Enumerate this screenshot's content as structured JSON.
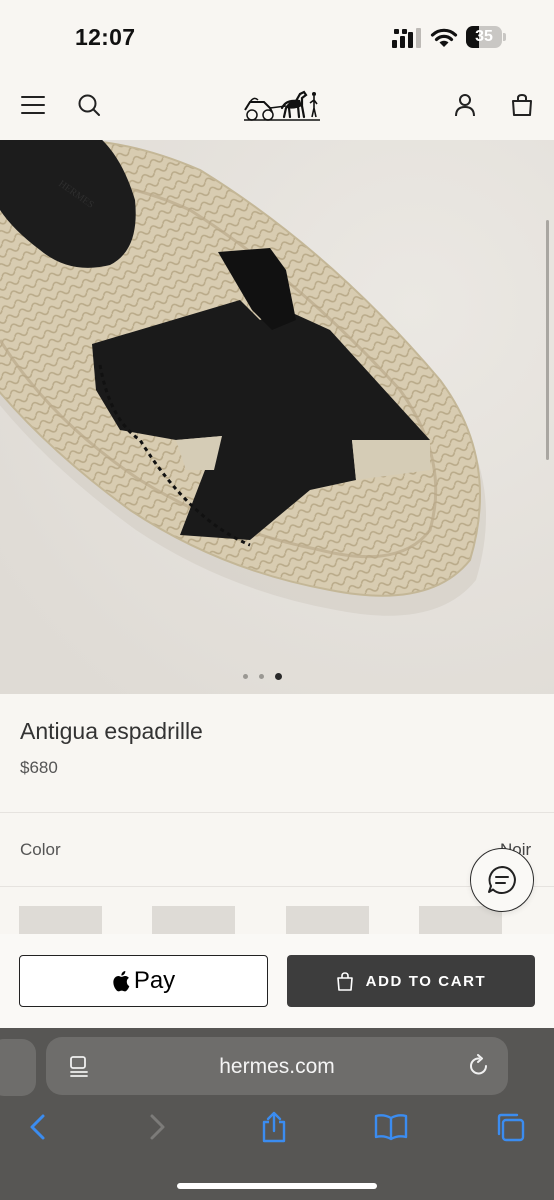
{
  "status_bar": {
    "time": "12:07",
    "battery_percent": "35",
    "icons": [
      "signal-icon",
      "wifi-icon",
      "battery-icon"
    ]
  },
  "header": {
    "icons": [
      "menu-icon",
      "search-icon",
      "hermes-logo",
      "account-icon",
      "shopping-bag-icon"
    ]
  },
  "gallery": {
    "image_count": 3,
    "active_index": 2
  },
  "product": {
    "name": "Antigua espadrille",
    "price": "$680"
  },
  "color": {
    "label": "Color",
    "value": "Noir"
  },
  "actions": {
    "apple_pay_label": "Pay",
    "add_to_cart_label": "ADD TO CART"
  },
  "browser": {
    "url": "hermes.com",
    "icons": [
      "reader-icon",
      "reload-icon",
      "back-icon",
      "forward-icon",
      "share-icon",
      "bookmarks-icon",
      "tabs-icon"
    ]
  },
  "colors": {
    "background": "#f8f6f2",
    "button_dark": "#3d3d3d",
    "browser_bar": "#575654",
    "browser_accent": "#3b8cf0"
  }
}
